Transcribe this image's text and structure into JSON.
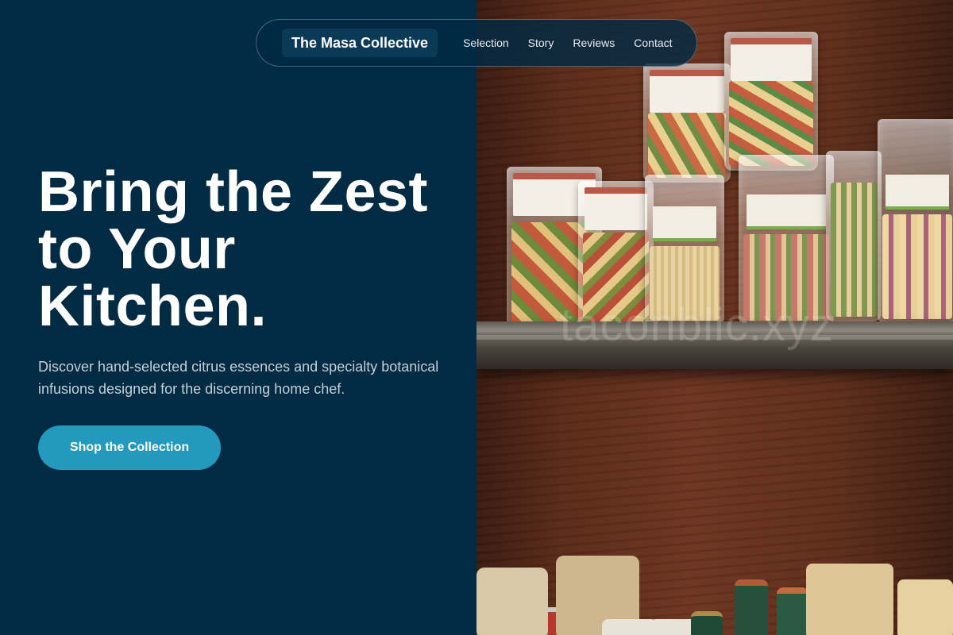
{
  "nav": {
    "brand": "The Masa Collective",
    "links": [
      "Selection",
      "Story",
      "Reviews",
      "Contact"
    ]
  },
  "hero": {
    "title_lines": [
      "Bring the Zest",
      "to Your",
      "Kitchen."
    ],
    "subtitle": "Discover hand-selected citrus essences and specialty botanical infusions designed for the discerning home chef.",
    "cta_label": "Shop the Collection"
  },
  "photo": {
    "watermark": "taconblic.xyz"
  },
  "colors": {
    "background": "#012a43",
    "brand_chip": "#0b3a57",
    "cta": "#2399bd",
    "text_primary": "#ffffff",
    "text_secondary": "#c4d0da"
  }
}
